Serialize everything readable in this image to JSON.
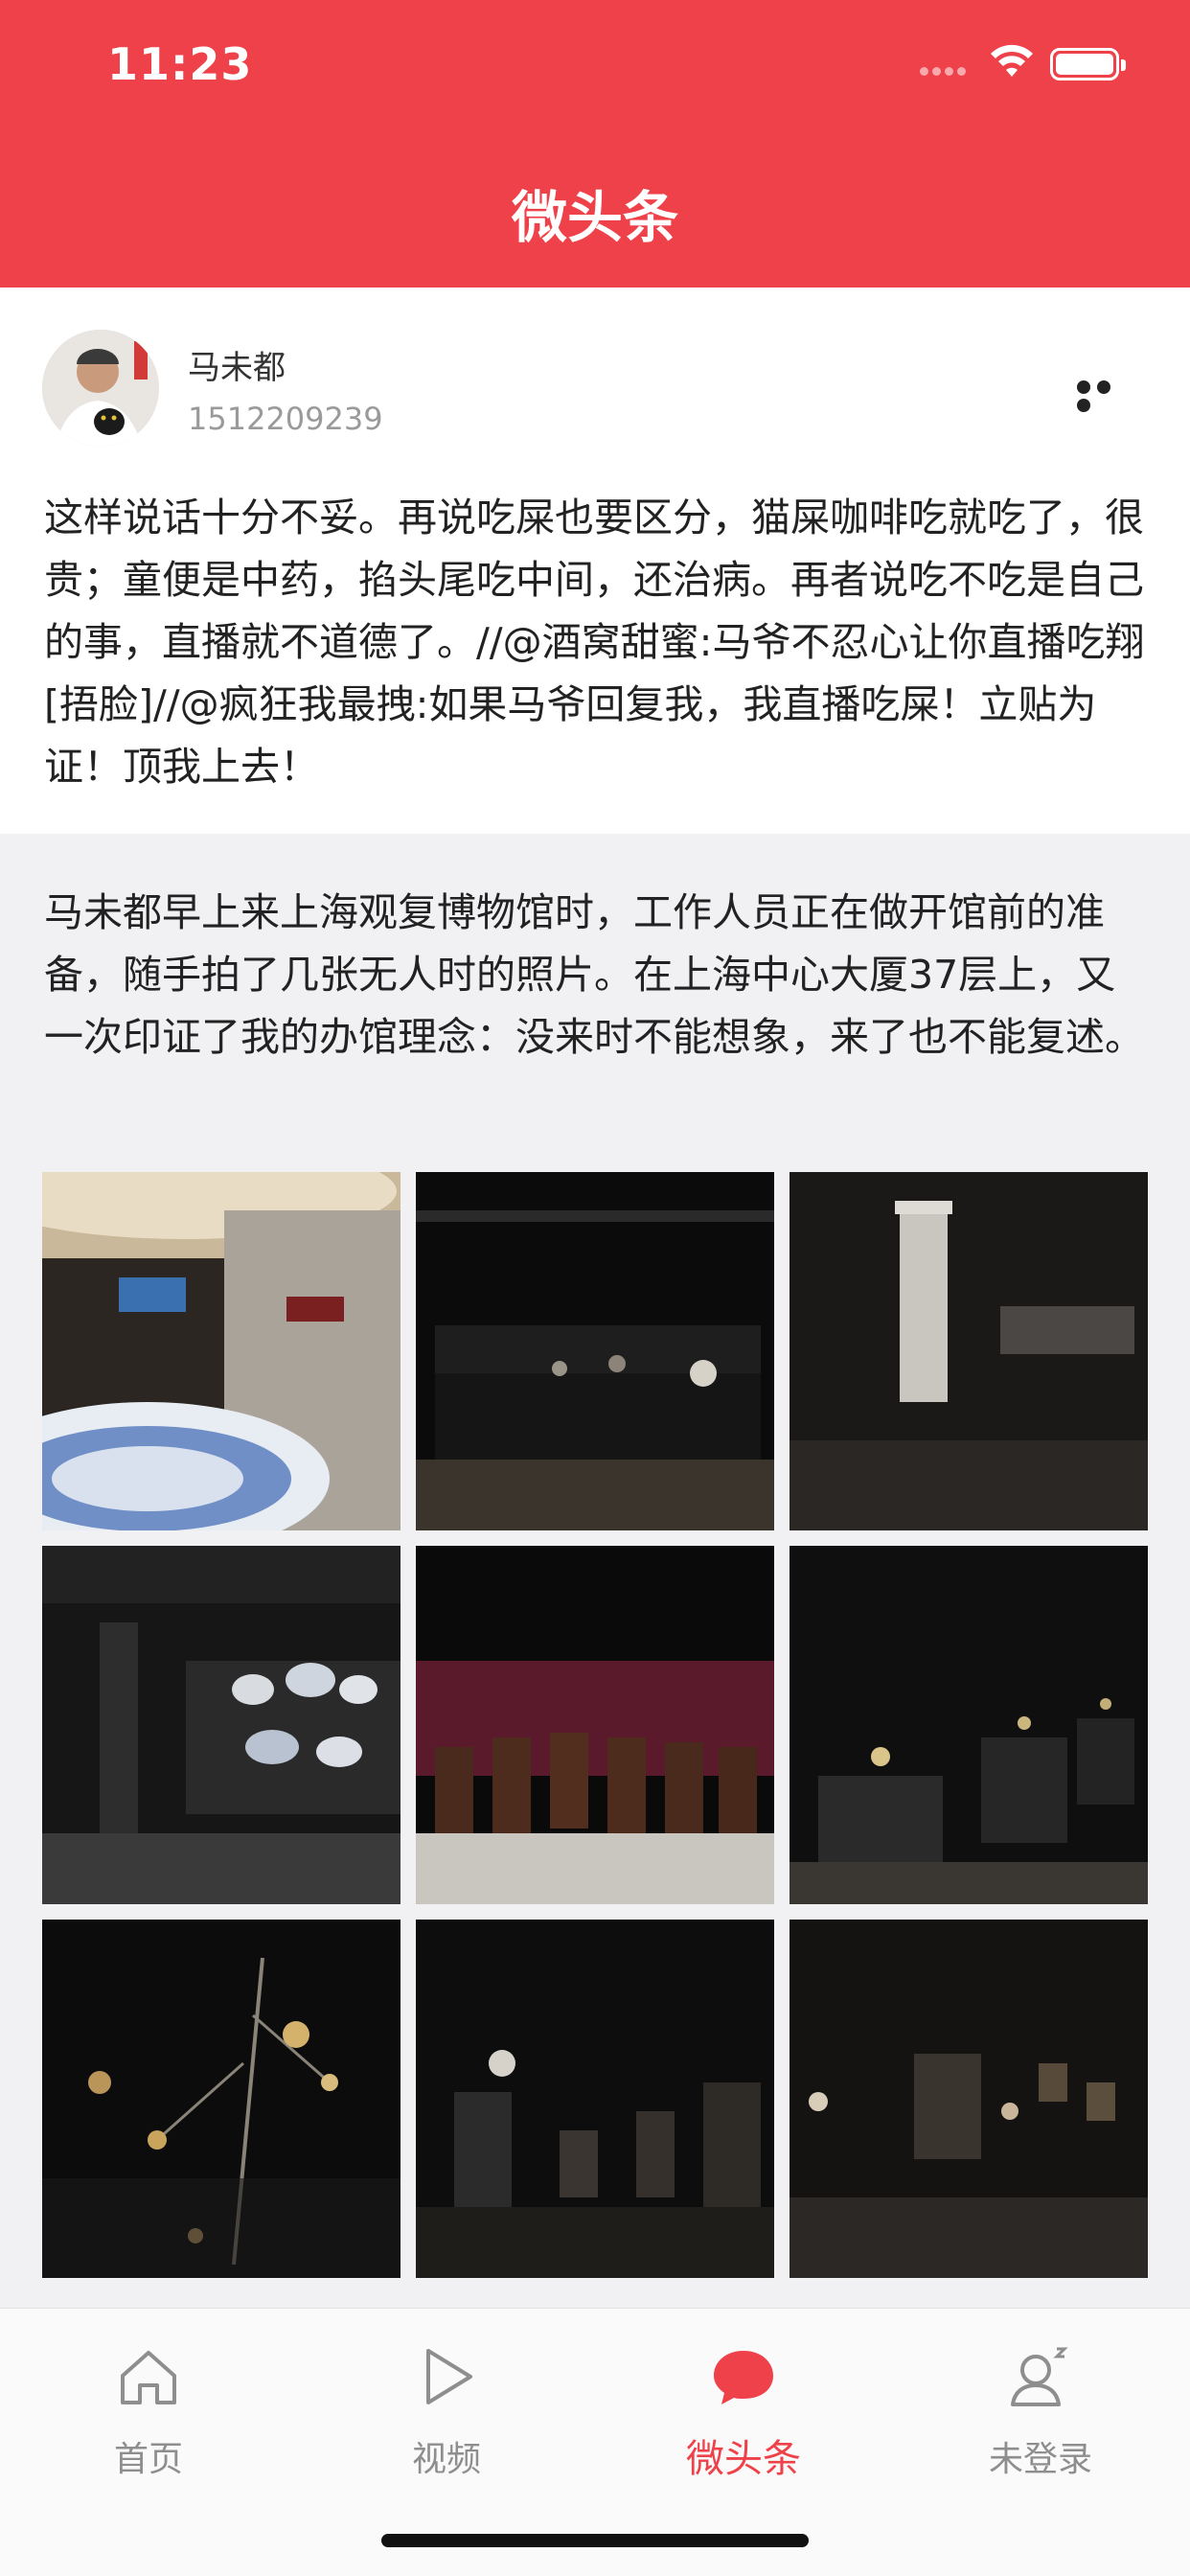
{
  "status_bar": {
    "time": "11:23"
  },
  "header": {
    "title": "微头条"
  },
  "post": {
    "author_name": "马未都",
    "author_id": "1512209239",
    "comment": "这样说话十分不妥。再说吃屎也要区分，猫屎咖啡吃就吃了，很贵；童便是中药，掐头尾吃中间，还治病。再者说吃不吃是自己的事，直播就不道德了。//@酒窝甜蜜:马爷不忍心让你直播吃翔[捂脸]//@疯狂我最拽:如果马爷回复我，我直播吃屎！立贴为证！顶我上去！",
    "repost_text": "马未都早上来上海观复博物馆时，工作人员正在做开馆前的准备，随手拍了几张无人时的照片。在上海中心大厦37层上，又一次印证了我的办馆理念：没来时不能想象，来了也不能复述。",
    "photos": [
      {
        "name": "museum-lobby-photo"
      },
      {
        "name": "dark-gallery-photo"
      },
      {
        "name": "bead-curtain-photo"
      },
      {
        "name": "porcelain-display-photo"
      },
      {
        "name": "chair-exhibit-photo"
      },
      {
        "name": "display-cases-photo"
      },
      {
        "name": "gold-artifacts-photo"
      },
      {
        "name": "buddha-statues-photo"
      },
      {
        "name": "niche-displays-photo"
      }
    ]
  },
  "tabbar": {
    "tabs": [
      {
        "label": "首页",
        "icon": "home-icon",
        "active": false
      },
      {
        "label": "视频",
        "icon": "play-icon",
        "active": false
      },
      {
        "label": "微头条",
        "icon": "chat-bubble-icon",
        "active": true
      },
      {
        "label": "未登录",
        "icon": "user-icon",
        "active": false
      }
    ]
  },
  "colors": {
    "brand_red": "#ef4149",
    "inactive_gray": "#8e8e8e",
    "repost_bg": "#f1f1f4"
  }
}
